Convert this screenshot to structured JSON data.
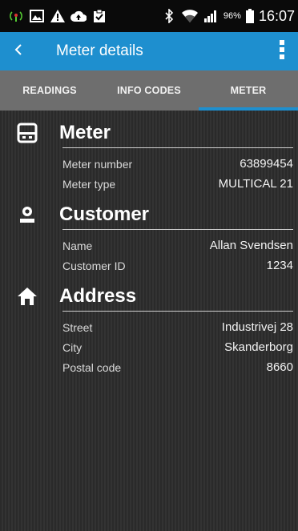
{
  "status_bar": {
    "battery_percent": "96%",
    "time": "16:07"
  },
  "toolbar": {
    "title": "Meter details"
  },
  "tabs": [
    {
      "label": "READINGS",
      "active": false
    },
    {
      "label": "INFO CODES",
      "active": false
    },
    {
      "label": "METER",
      "active": true
    }
  ],
  "colors": {
    "accent": "#1e8fcf",
    "status_bar": "#0a0a0a",
    "tab_bar": "#6e6e6e"
  },
  "sections": {
    "meter": {
      "title": "Meter",
      "icon": "meter-icon",
      "rows": [
        {
          "label": "Meter number",
          "value": "63899454"
        },
        {
          "label": "Meter type",
          "value": "MULTICAL 21"
        }
      ]
    },
    "customer": {
      "title": "Customer",
      "icon": "person-icon",
      "rows": [
        {
          "label": "Name",
          "value": "Allan Svendsen"
        },
        {
          "label": "Customer ID",
          "value": "1234"
        }
      ]
    },
    "address": {
      "title": "Address",
      "icon": "home-icon",
      "rows": [
        {
          "label": "Street",
          "value": "Industrivej 28"
        },
        {
          "label": "City",
          "value": "Skanderborg"
        },
        {
          "label": "Postal code",
          "value": "8660"
        }
      ]
    }
  }
}
